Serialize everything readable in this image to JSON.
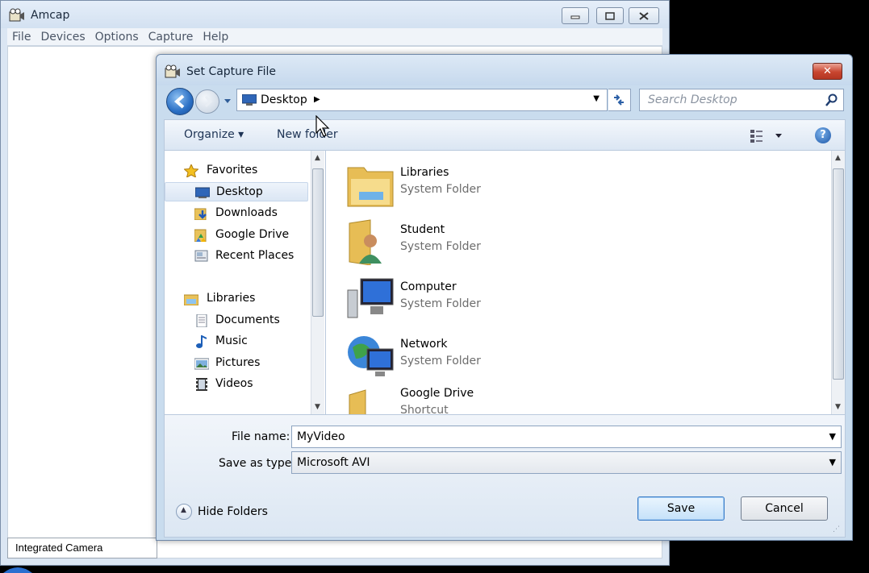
{
  "amcap": {
    "title": "Amcap",
    "menu": [
      "File",
      "Devices",
      "Options",
      "Capture",
      "Help"
    ],
    "status": "Integrated Camera"
  },
  "dialog": {
    "title": "Set Capture File",
    "address": "Desktop",
    "search_placeholder": "Search Desktop",
    "toolbar": {
      "organize": "Organize ▾",
      "new_folder": "New folder"
    },
    "nav": {
      "favorites": "Favorites",
      "favorites_items": [
        "Desktop",
        "Downloads",
        "Google Drive",
        "Recent Places"
      ],
      "libraries": "Libraries",
      "libraries_items": [
        "Documents",
        "Music",
        "Pictures",
        "Videos"
      ]
    },
    "files": [
      {
        "name": "Libraries",
        "type": "System Folder",
        "icon": "libraries-folder-icon"
      },
      {
        "name": "Student",
        "type": "System Folder",
        "icon": "user-folder-icon"
      },
      {
        "name": "Computer",
        "type": "System Folder",
        "icon": "computer-icon"
      },
      {
        "name": "Network",
        "type": "System Folder",
        "icon": "network-icon"
      },
      {
        "name": "Google Drive",
        "type": "Shortcut",
        "icon": "folder-shortcut-icon"
      }
    ],
    "file_name_label": "File name:",
    "file_name_value": "MyVideo",
    "save_type_label": "Save as type:",
    "save_type_value": "Microsoft AVI",
    "hide_folders": "Hide Folders",
    "save": "Save",
    "cancel": "Cancel"
  }
}
